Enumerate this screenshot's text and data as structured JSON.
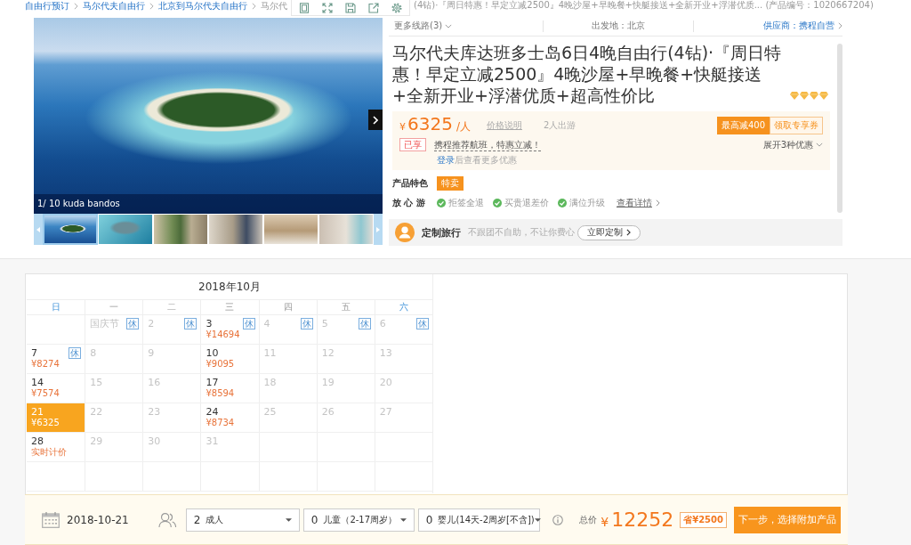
{
  "breadcrumb": {
    "items": [
      {
        "label": "自由行预订",
        "current": false
      },
      {
        "label": "马尔代夫自由行",
        "current": false
      },
      {
        "label": "北京到马尔代夫自由行",
        "current": false
      },
      {
        "label": "马尔代",
        "current": true
      }
    ],
    "title_tail": "(4钻)·『周日特惠！早定立减2500』4晚沙屋+早晚餐+快艇接送+全新开业+浮潜优质... (产品编号：1020667204)"
  },
  "gallery": {
    "caption": "1/ 10 kuda bandos",
    "thumbnails": [
      {
        "selected": true
      },
      {
        "selected": false
      },
      {
        "selected": false
      },
      {
        "selected": false
      },
      {
        "selected": false
      },
      {
        "selected": false
      }
    ]
  },
  "route_bar": {
    "more_routes": "更多线路(3)",
    "departure": "出发地：北京",
    "supplier": "供应商：携程自营"
  },
  "product": {
    "title": "马尔代夫库达班多士岛6日4晚自由行(4钻)·『周日特惠！早定立减2500』4晚沙屋+早晚餐+快艇接送+全新开业+浮潜优质+超高性价比",
    "stars": 4
  },
  "price": {
    "currency": "¥",
    "amount": "6325",
    "unit": "/人",
    "note_link": "价格说明",
    "travelers": "2人出游",
    "max_discount": "最高减400",
    "coupon": "领取专享券",
    "applied_tag": "已享",
    "applied_text": "携程推荐航班，特惠立减！",
    "expand": "展开3种优惠",
    "login_link": "登录",
    "login_hint": "后查看更多优惠"
  },
  "features": {
    "label": "产品特色",
    "tag": "特卖"
  },
  "assurance": {
    "label": "放 心 游",
    "items": [
      "拒签全退",
      "买贵退差价",
      "满位升级"
    ],
    "details": "查看详情"
  },
  "custom": {
    "title": "定制旅行",
    "slogan": "不跟团不自助，不让你费心",
    "button": "立即定制"
  },
  "calendar": {
    "title": "2018年10月",
    "weekdays": [
      {
        "label": "日",
        "weekend": true
      },
      {
        "label": "一",
        "weekend": false
      },
      {
        "label": "二",
        "weekend": false
      },
      {
        "label": "三",
        "weekend": false
      },
      {
        "label": "四",
        "weekend": false
      },
      {
        "label": "五",
        "weekend": false
      },
      {
        "label": "六",
        "weekend": true
      }
    ],
    "weeks": [
      [
        {
          "kind": "blank"
        },
        {
          "kind": "day",
          "day": "国庆节",
          "badge": "休",
          "available": false,
          "selected": false
        },
        {
          "kind": "day",
          "day": "2",
          "badge": "休",
          "available": false,
          "selected": false
        },
        {
          "kind": "day",
          "day": "3",
          "badge": "休",
          "price": "¥14694",
          "available": true,
          "selected": false
        },
        {
          "kind": "day",
          "day": "4",
          "badge": "休",
          "available": false,
          "selected": false
        },
        {
          "kind": "day",
          "day": "5",
          "badge": "休",
          "available": false,
          "selected": false
        },
        {
          "kind": "day",
          "day": "6",
          "badge": "休",
          "available": false,
          "selected": false
        }
      ],
      [
        {
          "kind": "day",
          "day": "7",
          "badge": "休",
          "price": "¥8274",
          "available": true,
          "selected": false
        },
        {
          "kind": "day",
          "day": "8",
          "available": false,
          "selected": false
        },
        {
          "kind": "day",
          "day": "9",
          "available": false,
          "selected": false
        },
        {
          "kind": "day",
          "day": "10",
          "price": "¥9095",
          "available": true,
          "selected": false
        },
        {
          "kind": "day",
          "day": "11",
          "available": false,
          "selected": false
        },
        {
          "kind": "day",
          "day": "12",
          "available": false,
          "selected": false
        },
        {
          "kind": "day",
          "day": "13",
          "available": false,
          "selected": false
        }
      ],
      [
        {
          "kind": "day",
          "day": "14",
          "price": "¥7574",
          "available": true,
          "selected": false
        },
        {
          "kind": "day",
          "day": "15",
          "available": false,
          "selected": false
        },
        {
          "kind": "day",
          "day": "16",
          "available": false,
          "selected": false
        },
        {
          "kind": "day",
          "day": "17",
          "price": "¥8594",
          "available": true,
          "selected": false
        },
        {
          "kind": "day",
          "day": "18",
          "available": false,
          "selected": false
        },
        {
          "kind": "day",
          "day": "19",
          "available": false,
          "selected": false
        },
        {
          "kind": "day",
          "day": "20",
          "available": false,
          "selected": false
        }
      ],
      [
        {
          "kind": "day",
          "day": "21",
          "price": "¥6325",
          "available": true,
          "selected": true
        },
        {
          "kind": "day",
          "day": "22",
          "available": false,
          "selected": false
        },
        {
          "kind": "day",
          "day": "23",
          "available": false,
          "selected": false
        },
        {
          "kind": "day",
          "day": "24",
          "price": "¥8734",
          "available": true,
          "selected": false
        },
        {
          "kind": "day",
          "day": "25",
          "available": false,
          "selected": false
        },
        {
          "kind": "day",
          "day": "26",
          "available": false,
          "selected": false
        },
        {
          "kind": "day",
          "day": "27",
          "available": false,
          "selected": false
        }
      ],
      [
        {
          "kind": "day",
          "day": "28",
          "price": "实时计价",
          "available": true,
          "selected": false
        },
        {
          "kind": "day",
          "day": "29",
          "available": false,
          "selected": false
        },
        {
          "kind": "day",
          "day": "30",
          "available": false,
          "selected": false
        },
        {
          "kind": "day",
          "day": "31",
          "available": false,
          "selected": false
        },
        {
          "kind": "blank"
        },
        {
          "kind": "blank"
        },
        {
          "kind": "blank"
        }
      ],
      [
        {
          "kind": "blank"
        },
        {
          "kind": "blank"
        },
        {
          "kind": "blank"
        },
        {
          "kind": "blank"
        },
        {
          "kind": "blank"
        },
        {
          "kind": "blank"
        },
        {
          "kind": "blank"
        }
      ]
    ]
  },
  "booking": {
    "date": "2018-10-21",
    "passengers": [
      {
        "value": "2",
        "label": "成人"
      },
      {
        "value": "0",
        "label": "儿童（2-17周岁）"
      },
      {
        "value": "0",
        "label": "婴儿(14天-2周岁[不含])"
      }
    ],
    "total_label": "总价",
    "currency": "¥",
    "total": "12252",
    "saving": "省¥2500",
    "next_button": "下一步，选择附加产品"
  }
}
